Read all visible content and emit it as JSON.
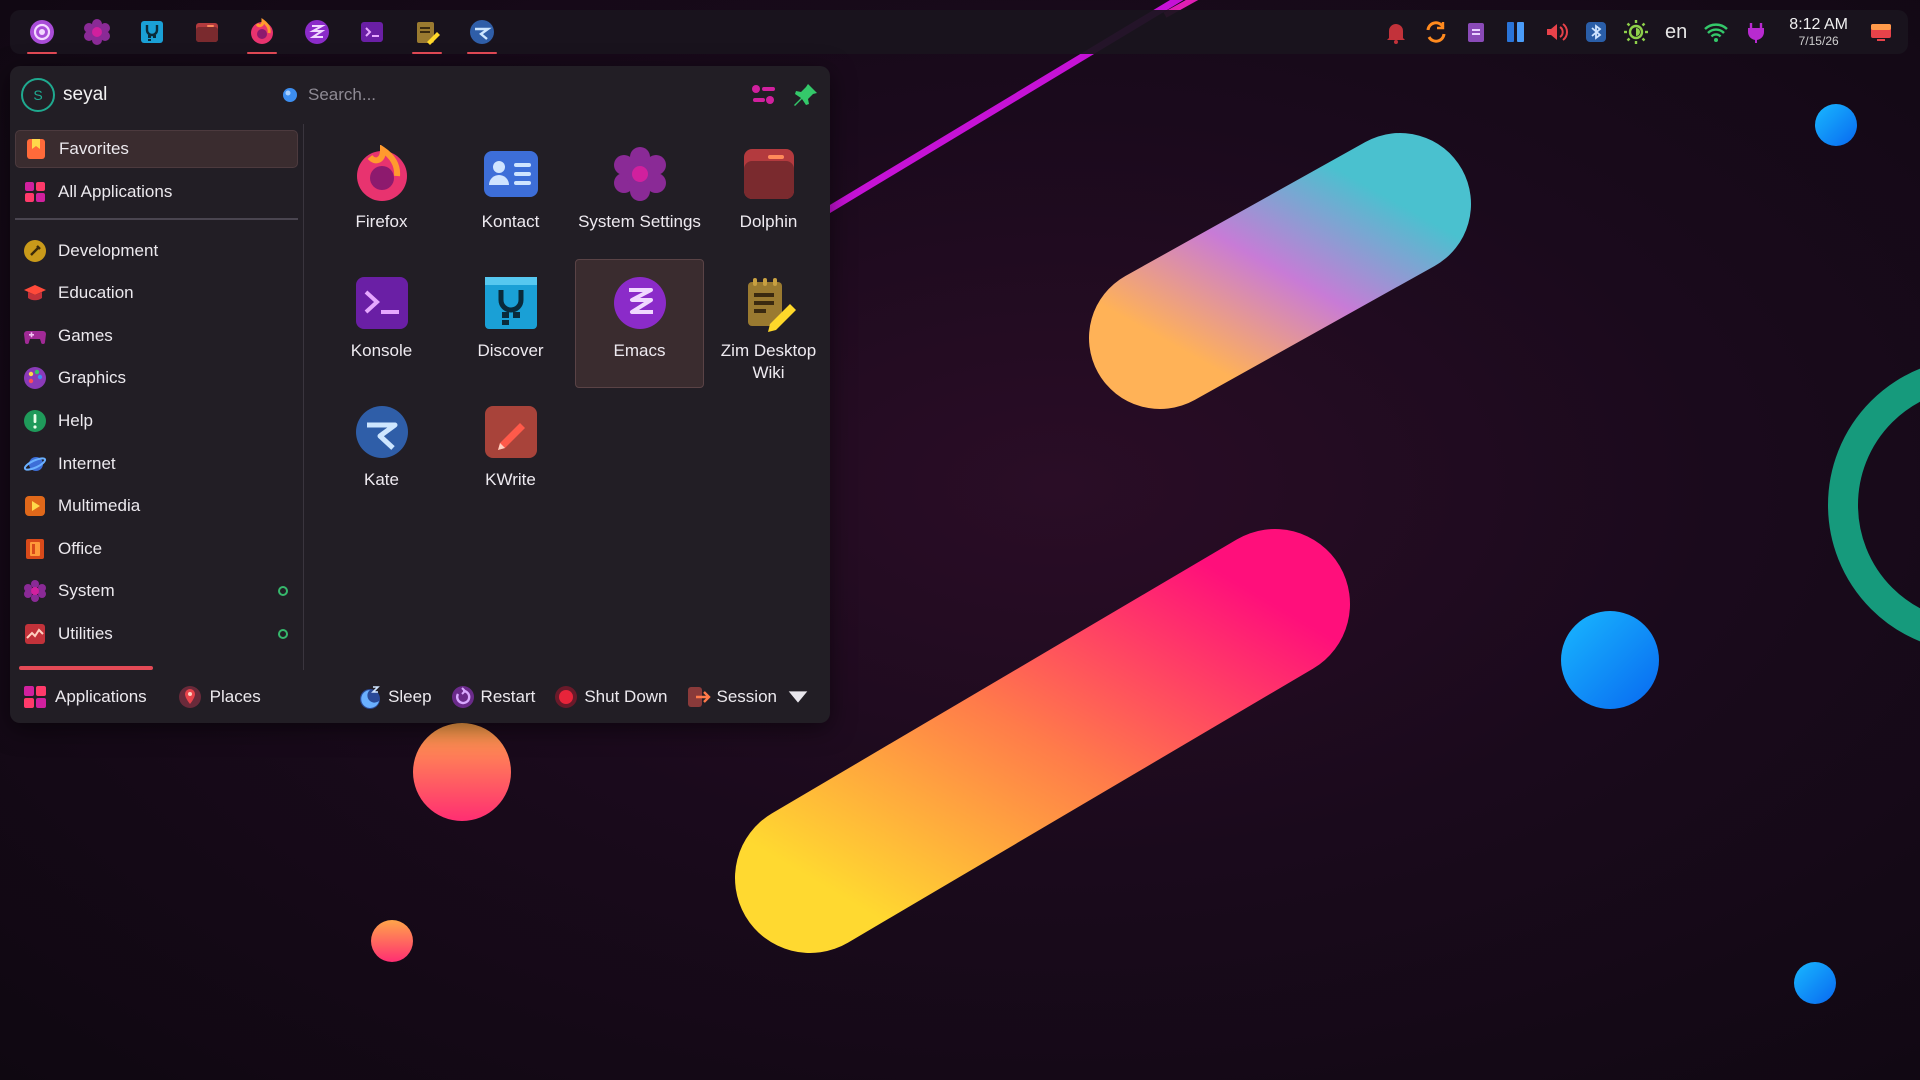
{
  "panel": {
    "tasks": [
      {
        "name": "launcher-icon",
        "active": true
      },
      {
        "name": "system-settings-icon",
        "active": false
      },
      {
        "name": "discover-icon",
        "active": false
      },
      {
        "name": "dolphin-icon",
        "active": false
      },
      {
        "name": "firefox-icon",
        "active": true
      },
      {
        "name": "emacs-icon",
        "active": false
      },
      {
        "name": "konsole-icon",
        "active": false
      },
      {
        "name": "zim-icon",
        "active": true
      },
      {
        "name": "kate-icon",
        "active": true
      }
    ],
    "tray": {
      "language": "en",
      "time": "8:12 AM",
      "date": "7/15/26"
    }
  },
  "launcher": {
    "user_initial": "S",
    "username": "seyal",
    "search_placeholder": "Search...",
    "categories": [
      {
        "label": "Favorites",
        "icon": "favorites-icon",
        "selected": true
      },
      {
        "label": "All Applications",
        "icon": "grid-icon"
      },
      {
        "label": "Development",
        "icon": "development-icon"
      },
      {
        "label": "Education",
        "icon": "education-icon"
      },
      {
        "label": "Games",
        "icon": "gamepad-icon"
      },
      {
        "label": "Graphics",
        "icon": "palette-icon"
      },
      {
        "label": "Help",
        "icon": "help-icon"
      },
      {
        "label": "Internet",
        "icon": "globe-icon"
      },
      {
        "label": "Multimedia",
        "icon": "multimedia-icon"
      },
      {
        "label": "Office",
        "icon": "office-icon"
      },
      {
        "label": "System",
        "icon": "system-icon",
        "new": true
      },
      {
        "label": "Utilities",
        "icon": "utilities-icon",
        "new": true
      }
    ],
    "apps": [
      {
        "label": "Firefox",
        "icon": "firefox-icon"
      },
      {
        "label": "Kontact",
        "icon": "kontact-icon"
      },
      {
        "label": "System Settings",
        "icon": "system-settings-icon"
      },
      {
        "label": "Dolphin",
        "icon": "dolphin-icon"
      },
      {
        "label": "Konsole",
        "icon": "konsole-icon"
      },
      {
        "label": "Discover",
        "icon": "discover-icon"
      },
      {
        "label": "Emacs",
        "icon": "emacs-icon",
        "hovered": true
      },
      {
        "label": "Zim Desktop Wiki",
        "icon": "zim-icon"
      },
      {
        "label": "Kate",
        "icon": "kate-icon"
      },
      {
        "label": "KWrite",
        "icon": "kwrite-icon"
      }
    ],
    "footer": {
      "tabs": [
        {
          "label": "Applications",
          "icon": "applications-icon",
          "active": true
        },
        {
          "label": "Places",
          "icon": "places-icon"
        }
      ],
      "power": [
        {
          "label": "Sleep",
          "icon": "sleep-icon"
        },
        {
          "label": "Restart",
          "icon": "restart-icon"
        },
        {
          "label": "Shut Down",
          "icon": "shutdown-icon"
        },
        {
          "label": "Session",
          "icon": "session-icon"
        }
      ]
    }
  },
  "colors": {
    "accent": "#e44a56",
    "teal": "#1fa98f",
    "panel_bg": "#1a141e",
    "menu_bg": "#221e25",
    "selection": "#3a2c2f"
  }
}
